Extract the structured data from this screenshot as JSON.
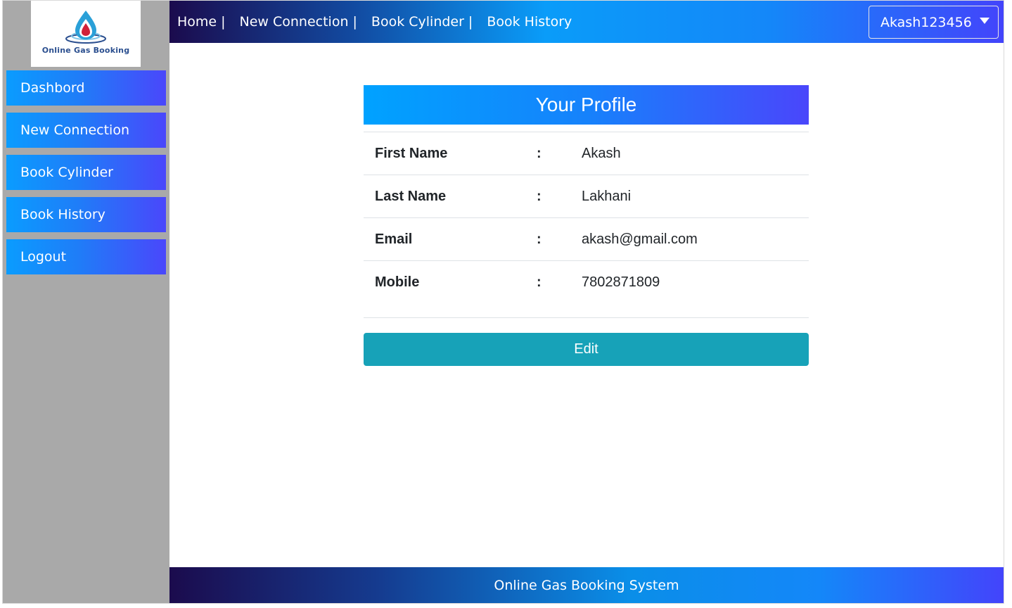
{
  "logo": {
    "text": "Online Gas Booking",
    "icon": "gas-flame-logo-icon"
  },
  "sidebar": {
    "items": [
      {
        "label": "Dashbord"
      },
      {
        "label": "New Connection"
      },
      {
        "label": "Book Cylinder"
      },
      {
        "label": "Book History"
      },
      {
        "label": "Logout"
      }
    ]
  },
  "topnav": {
    "links": [
      {
        "label": "Home",
        "sep": "|"
      },
      {
        "label": "New Connection",
        "sep": "|"
      },
      {
        "label": "Book Cylinder",
        "sep": "|"
      },
      {
        "label": "Book History"
      }
    ],
    "user": {
      "label": "Akash123456",
      "icon": "caret-down-icon"
    }
  },
  "profile": {
    "title": "Your Profile",
    "colon": ":",
    "fields": [
      {
        "label": "First Name",
        "value": "Akash"
      },
      {
        "label": "Last Name",
        "value": "Lakhani"
      },
      {
        "label": "Email",
        "value": "akash@gmail.com"
      },
      {
        "label": "Mobile",
        "value": "7802871809"
      }
    ],
    "edit_label": "Edit"
  },
  "footer": {
    "text": "Online Gas Booking System"
  },
  "colors": {
    "edit_button": "#17a2b8",
    "sidebar_bg": "#a9a9a9",
    "accent_blue": "#0a9cff",
    "accent_violet": "#4a47fb"
  }
}
